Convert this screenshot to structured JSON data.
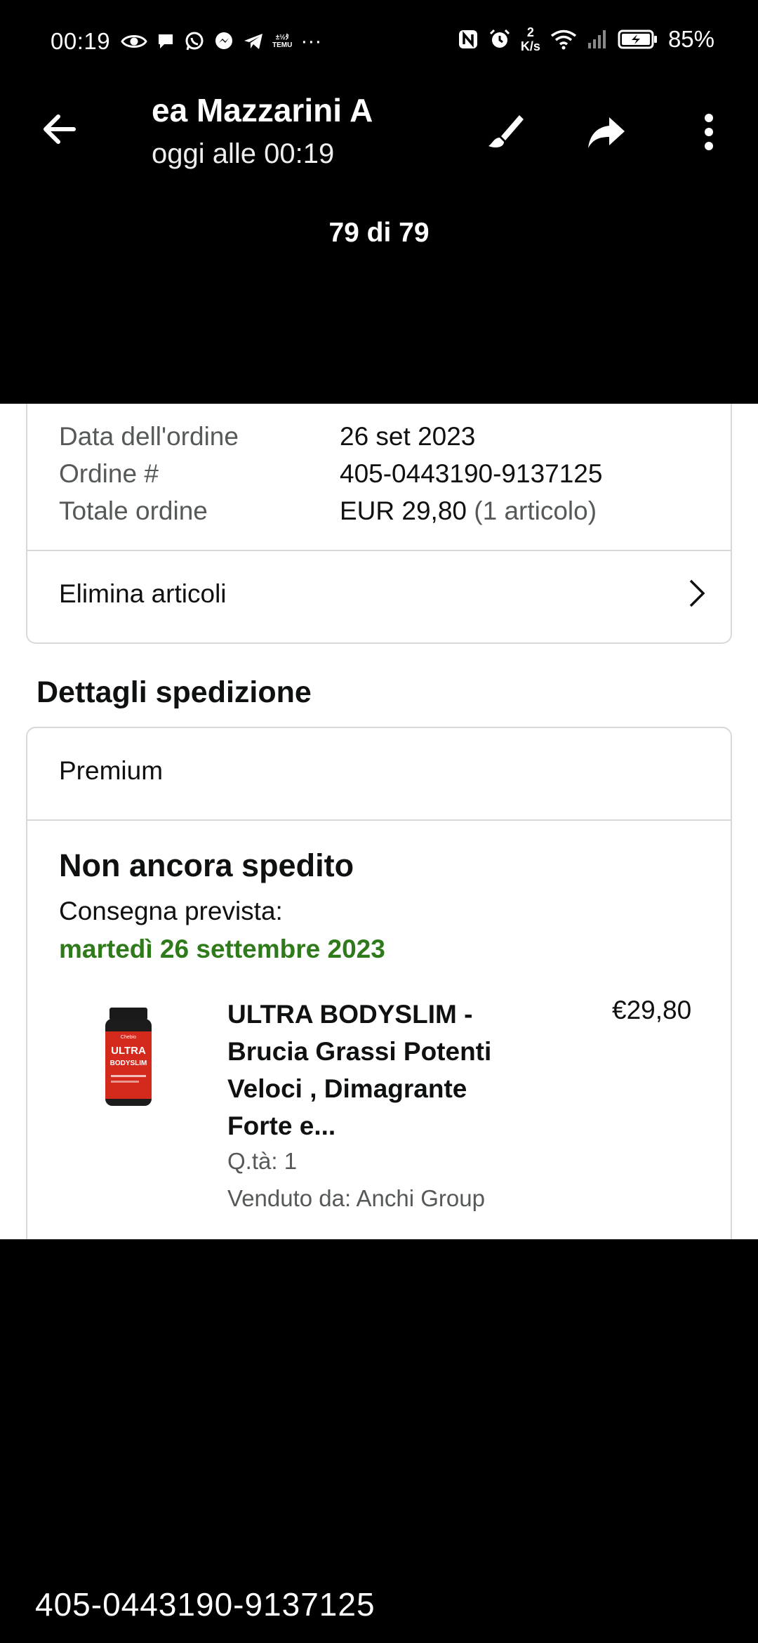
{
  "status_bar": {
    "time": "00:19",
    "net_speed_value": "2",
    "net_speed_unit": "K/s",
    "battery": "85%",
    "icons": [
      "eye-icon",
      "chat-bubble-icon",
      "whatsapp-icon",
      "messenger-icon",
      "telegram-icon",
      "temu-icon",
      "more-dots-icon",
      "nfc-icon",
      "alarm-icon",
      "wifi-icon",
      "signal-icon",
      "battery-charging-icon"
    ],
    "temu_top": "±½ﾀ",
    "temu_bottom": "TEMU",
    "dots": "···"
  },
  "toolbar": {
    "title": "ea Mazzarini   A",
    "subtitle": "oggi alle 00:19",
    "counter": "79 di 79"
  },
  "order": {
    "rows": [
      {
        "label": "Data dell'ordine",
        "value": "26 set 2023",
        "extra": ""
      },
      {
        "label": "Ordine #",
        "value": "405-0443190-9137125",
        "extra": ""
      },
      {
        "label": "Totale ordine",
        "value": "EUR 29,80",
        "extra": " (1 articolo)"
      }
    ],
    "delete_items": "Elimina articoli"
  },
  "shipping": {
    "section_title": "Dettagli spedizione",
    "service": "Premium",
    "status": "Non ancora spedito",
    "delivery_label": "Consegna prevista:",
    "delivery_date": "martedì 26 settembre 2023"
  },
  "product": {
    "title": "ULTRA BODYSLIM - Brucia Grassi Potenti Veloci , Dimagrante Forte e...",
    "price": "€29,80",
    "qty": "Q.tà: 1",
    "seller": "Venduto da: Anchi Group",
    "label_brand": "Chebio",
    "label_line1": "ULTRA",
    "label_line2": "BODYSLIM"
  },
  "caption": "405-0443190-9137125",
  "colors": {
    "background": "#000000",
    "card_border": "#d5d9d9",
    "secondary_text": "#565959",
    "delivery_green": "#2f7a1a"
  }
}
